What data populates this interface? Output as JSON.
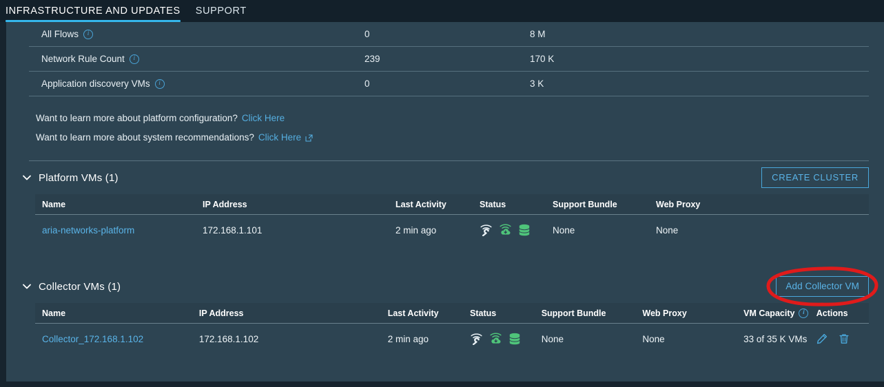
{
  "tabs": [
    {
      "label": "INFRASTRUCTURE AND UPDATES",
      "active": true
    },
    {
      "label": "SUPPORT",
      "active": false
    }
  ],
  "metrics": {
    "rows": [
      {
        "label": "All Flows",
        "info": "info-icon",
        "value1": "0",
        "value2": "8 M"
      },
      {
        "label": "Network Rule Count",
        "info": "info-icon",
        "value1": "239",
        "value2": "170 K"
      },
      {
        "label": "Application discovery VMs",
        "info": "info-icon",
        "value1": "0",
        "value2": "3 K"
      }
    ]
  },
  "learn_more": [
    {
      "question": "Want to learn more about platform configuration?",
      "link": "Click Here",
      "external": false
    },
    {
      "question": "Want to learn more about system recommendations?",
      "link": "Click Here",
      "external": true
    }
  ],
  "platform_section": {
    "title": "Platform VMs (1)",
    "chevron": "chevron-down-icon",
    "button": "CREATE CLUSTER",
    "columns": [
      "Name",
      "IP Address",
      "Last Activity",
      "Status",
      "Support Bundle",
      "Web Proxy"
    ],
    "rows": [
      {
        "name": "aria-networks-platform",
        "ip": "172.168.1.101",
        "last_activity": "2 min ago",
        "status_icons": [
          "wifi-wrench-icon",
          "wifi-cloud-download-icon",
          "database-stack-icon"
        ],
        "support_bundle": "None",
        "web_proxy": "None"
      }
    ]
  },
  "collector_section": {
    "title": "Collector VMs (1)",
    "chevron": "chevron-down-icon",
    "button": "Add Collector VM",
    "button_annotation": "red-ellipse-highlight",
    "columns": [
      "Name",
      "IP Address",
      "Last Activity",
      "Status",
      "Support Bundle",
      "Web Proxy",
      "VM Capacity",
      "Actions"
    ],
    "capacity_info": "info-icon",
    "rows": [
      {
        "name": "Collector_172.168.1.102",
        "ip": "172.168.1.102",
        "last_activity": "2 min ago",
        "status_icons": [
          "wifi-wrench-icon",
          "wifi-cloud-download-icon",
          "database-stack-icon"
        ],
        "support_bundle": "None",
        "web_proxy": "None",
        "vm_capacity": "33 of 35 K VMs",
        "actions": [
          "edit-pencil-icon",
          "delete-trash-icon"
        ]
      }
    ]
  },
  "colors": {
    "header_bg": "#13202a",
    "page_bg": "#2d4452",
    "accent_blue": "#35b7ec",
    "link_blue": "#55aee0",
    "status_green": "#4fc47a",
    "annotation_red": "#e01b1b"
  }
}
